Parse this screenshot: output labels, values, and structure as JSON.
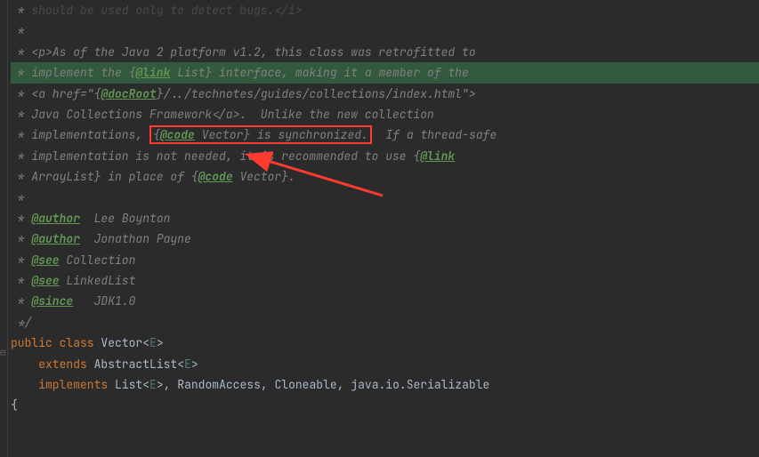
{
  "code": {
    "l0_a": " * ",
    "l0_b": "should be used only to detect bugs.</i>",
    "l1": " *",
    "l2_a": " * <p>",
    "l2_b": "As of the Java 2 platform v1.2, this class was retrofitted to",
    "l3_a": " * implement the {",
    "l3_link": "@link",
    "l3_b": " List",
    "l3_c": "} interface, making it a member of the",
    "l4_a": " * <a href=\"{",
    "l4_doc": "@docRoot",
    "l4_b": "}/../technotes/guides/collections/index.html\">",
    "l5": " * Java Collections Framework</a>.  Unlike the new collection",
    "l6_a": " * implementations, ",
    "l6_box_a": "{",
    "l6_box_code": "@code",
    "l6_box_b": " Vector} is synchronized.",
    "l6_c": "  If a thread-safe",
    "l7_a": " * implementation is not needed, it is recommended to use {",
    "l7_link": "@link",
    "l8_a": " * ArrayList",
    "l8_b": "} in place of {",
    "l8_code": "@code",
    "l8_c": " Vector}.",
    "l9": " *",
    "l10_a": " * ",
    "l10_tag": "@author",
    "l10_b": "  Lee Boynton",
    "l11_a": " * ",
    "l11_tag": "@author",
    "l11_b": "  Jonathan Payne",
    "l12_a": " * ",
    "l12_tag": "@see",
    "l12_b": " Collection",
    "l13_a": " * ",
    "l13_tag": "@see",
    "l13_b": " LinkedList",
    "l14_a": " * ",
    "l14_tag": "@since",
    "l14_b": "   JDK1.0",
    "l15": " */",
    "l16_pub": "public ",
    "l16_cls": "class ",
    "l16_name": "Vector",
    "l16_lt": "<",
    "l16_e": "E",
    "l16_gt": ">",
    "l17_ind": "    ",
    "l17_ext": "extends ",
    "l17_name": "AbstractList",
    "l17_lt": "<",
    "l17_e": "E",
    "l17_gt": ">",
    "l18_ind": "    ",
    "l18_imp": "implements ",
    "l18_a": "List",
    "l18_lt": "<",
    "l18_e": "E",
    "l18_gt": ">",
    "l18_c1": ", ",
    "l18_b": "RandomAccess",
    "l18_c2": ", ",
    "l18_c": "Cloneable",
    "l18_c3": ", ",
    "l18_d": "java.io.Serializable",
    "l19": "{"
  }
}
